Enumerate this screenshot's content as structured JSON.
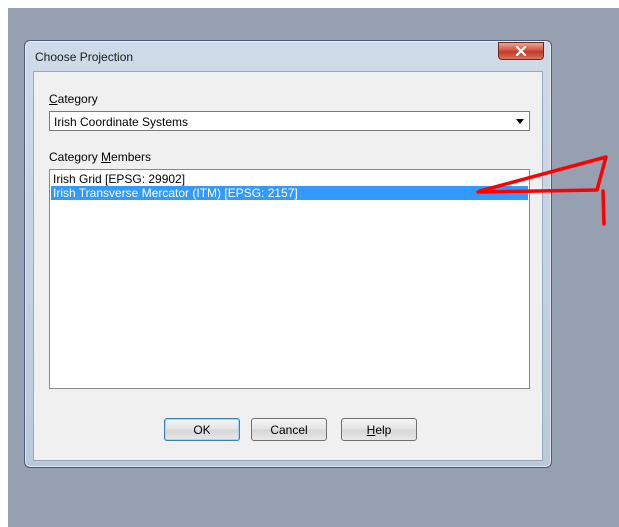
{
  "window": {
    "title": "Choose Projection",
    "close_icon": "close-icon"
  },
  "category": {
    "label_prefix": "",
    "label_underlined": "C",
    "label_rest": "ategory",
    "selected": "Irish Coordinate Systems"
  },
  "members": {
    "label_prefix": "Category ",
    "label_underlined": "M",
    "label_rest": "embers",
    "items": [
      {
        "label": "Irish Grid [EPSG: 29902]",
        "selected": false
      },
      {
        "label": "Irish Transverse Mercator (ITM) [EPSG: 2157]",
        "selected": true
      }
    ]
  },
  "buttons": {
    "ok": "OK",
    "cancel": "Cancel",
    "help_underlined": "H",
    "help_rest": "elp"
  },
  "colors": {
    "selection": "#3399ff",
    "annotation": "#ff0000",
    "desktop": "#97a0b0"
  }
}
